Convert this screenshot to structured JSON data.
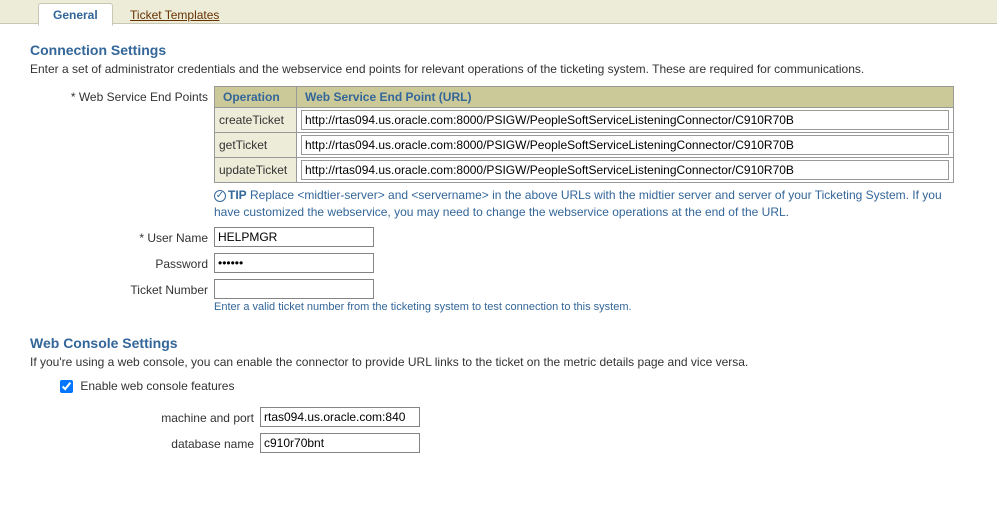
{
  "tabs": {
    "general": "General",
    "templates": "Ticket Templates"
  },
  "connection": {
    "title": "Connection Settings",
    "desc": "Enter a set of administrator credentials and the webservice end points for relevant operations of the ticketing system. These are required for communications.",
    "endpoints_label": "* Web Service End Points",
    "table": {
      "col_operation": "Operation",
      "col_url": "Web Service End Point (URL)",
      "rows": [
        {
          "op": "createTicket",
          "url": "http://rtas094.us.oracle.com:8000/PSIGW/PeopleSoftServiceListeningConnector/C910R70B"
        },
        {
          "op": "getTicket",
          "url": "http://rtas094.us.oracle.com:8000/PSIGW/PeopleSoftServiceListeningConnector/C910R70B"
        },
        {
          "op": "updateTicket",
          "url": "http://rtas094.us.oracle.com:8000/PSIGW/PeopleSoftServiceListeningConnector/C910R70B"
        }
      ]
    },
    "tip_label": "TIP",
    "tip_text": " Replace <midtier-server> and <servername> in the above URLs with the midtier server and server of your Ticketing System. If you have customized the webservice, you may need to change the webservice operations at the end of the URL.",
    "user_label": "* User Name",
    "user_value": "HELPMGR",
    "password_label": "Password",
    "password_value": "••••••",
    "ticket_label": "Ticket Number",
    "ticket_value": "",
    "ticket_hint": "Enter a valid ticket number from the ticketing system to test connection to this system."
  },
  "webconsole": {
    "title": "Web Console Settings",
    "desc": "If you're using a web console, you can enable the connector to provide URL links to the ticket on the metric details page and vice versa.",
    "enable_label": "Enable web console features",
    "machine_label": "machine and port",
    "machine_value": "rtas094.us.oracle.com:840",
    "db_label": "database name",
    "db_value": "c910r70bnt"
  }
}
